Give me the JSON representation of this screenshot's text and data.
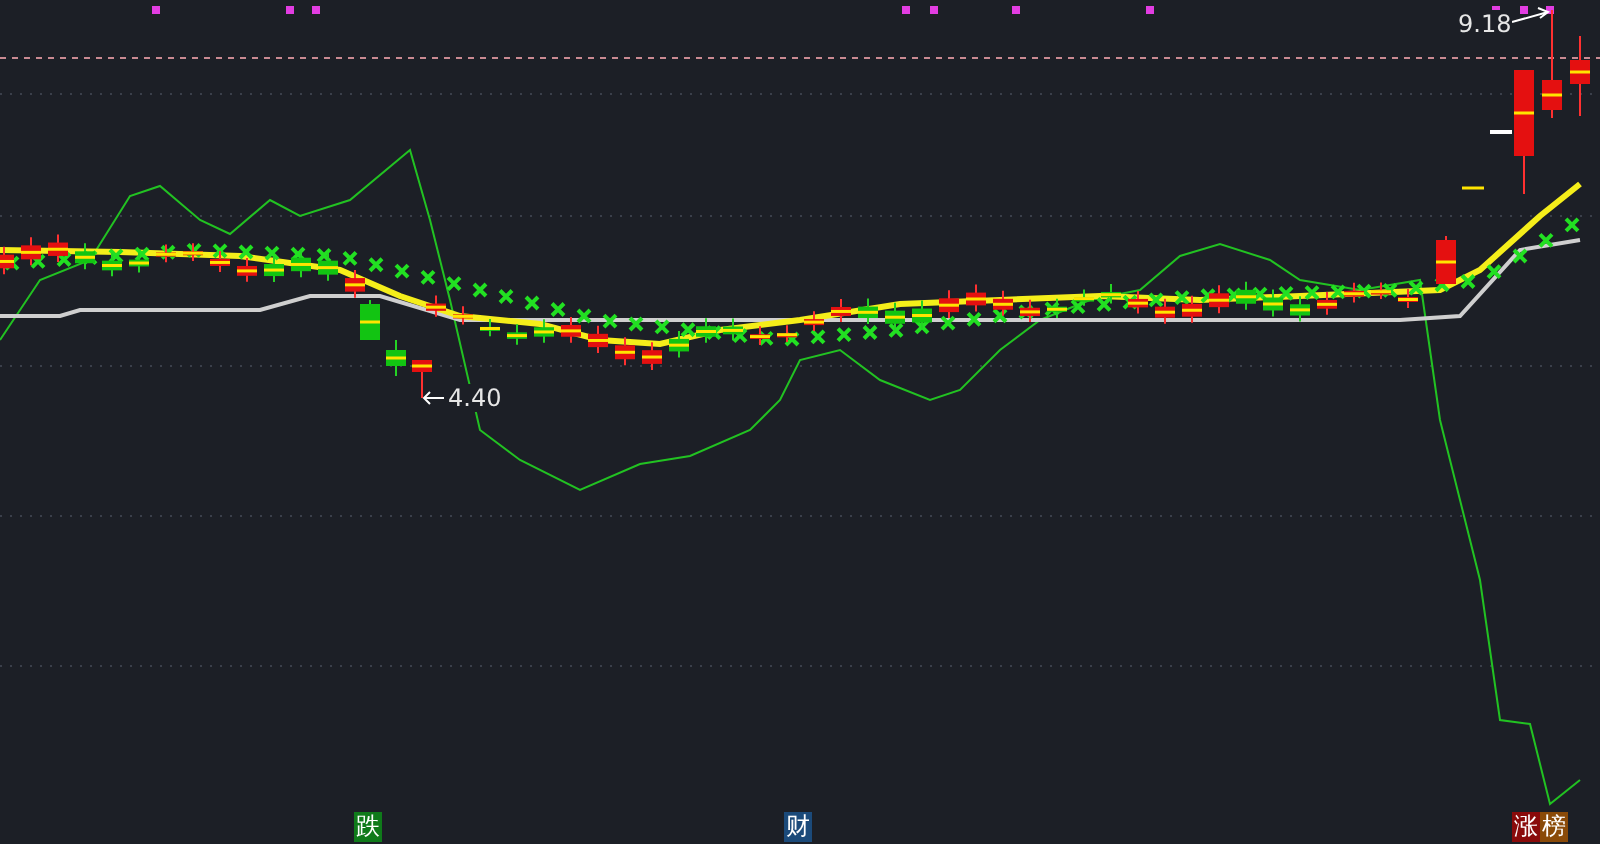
{
  "price_labels": [
    {
      "kind": "high",
      "text": "9.18"
    },
    {
      "kind": "low",
      "text": "4.40"
    }
  ],
  "markers": [
    {
      "text": "跌",
      "color": "#0f7a1a"
    },
    {
      "text": "财",
      "color": "#1b4a7a"
    },
    {
      "text": "涨",
      "color": "#8a0a0a"
    },
    {
      "text": "榜",
      "color": "#8a4a08"
    }
  ]
}
